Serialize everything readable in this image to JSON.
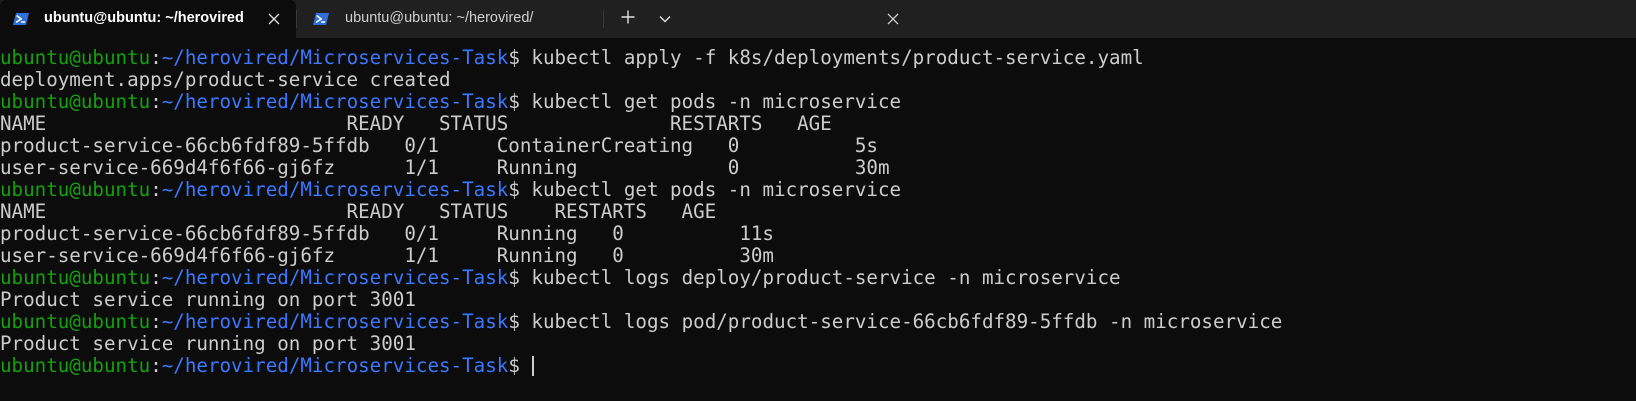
{
  "tabs": [
    {
      "title": "ubuntu@ubuntu: ~/herovired",
      "active": true,
      "icon": "powershell-icon"
    },
    {
      "title": "ubuntu@ubuntu: ~/herovired/",
      "active": false,
      "icon": "powershell-icon"
    }
  ],
  "colors": {
    "user_host": "#13a10e",
    "path": "#3b78ff",
    "text": "#cccccc",
    "background": "#0c0c0c",
    "tabbar": "#202020"
  },
  "prompt": {
    "user_host": "ubuntu@ubuntu",
    "sep": ":",
    "path": "~/herovired/Microservices-Task",
    "symbol": "$ "
  },
  "lines": [
    {
      "type": "cmd",
      "text": "kubectl apply -f k8s/deployments/product-service.yaml"
    },
    {
      "type": "out",
      "text": "deployment.apps/product-service created"
    },
    {
      "type": "cmd",
      "text": "kubectl get pods -n microservice"
    },
    {
      "type": "out",
      "text": "NAME                          READY   STATUS              RESTARTS   AGE"
    },
    {
      "type": "out",
      "text": "product-service-66cb6fdf89-5ffdb   0/1     ContainerCreating   0          5s"
    },
    {
      "type": "out",
      "text": "user-service-669d4f6f66-gj6fz      1/1     Running             0          30m"
    },
    {
      "type": "cmd",
      "text": "kubectl get pods -n microservice"
    },
    {
      "type": "out",
      "text": "NAME                          READY   STATUS    RESTARTS   AGE"
    },
    {
      "type": "out",
      "text": "product-service-66cb6fdf89-5ffdb   0/1     Running   0          11s"
    },
    {
      "type": "out",
      "text": "user-service-669d4f6f66-gj6fz      1/1     Running   0          30m"
    },
    {
      "type": "cmd",
      "text": "kubectl logs deploy/product-service -n microservice"
    },
    {
      "type": "out",
      "text": "Product service running on port 3001"
    },
    {
      "type": "cmd",
      "text": "kubectl logs pod/product-service-66cb6fdf89-5ffdb -n microservice"
    },
    {
      "type": "out",
      "text": "Product service running on port 3001"
    },
    {
      "type": "prompt",
      "text": ""
    }
  ]
}
